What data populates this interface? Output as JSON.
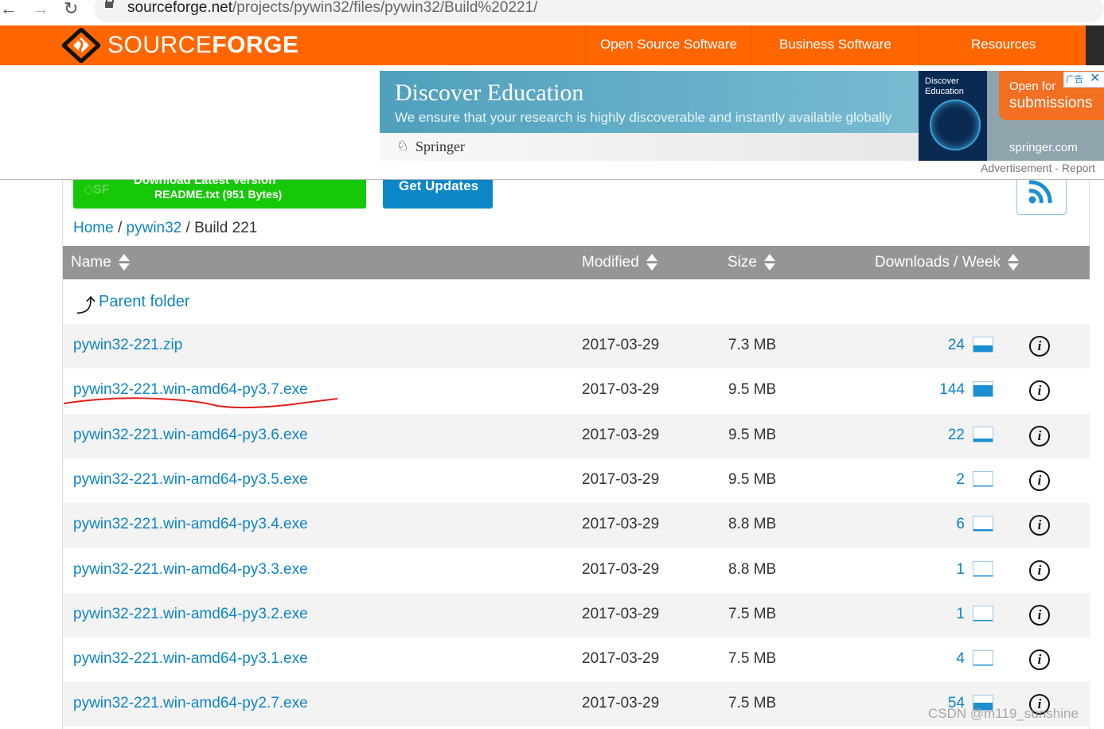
{
  "browser": {
    "url_host": "sourceforge.net",
    "url_path": "/projects/pywin32/files/pywin32/Build%20221/"
  },
  "header": {
    "logo_light": "SOURCE",
    "logo_bold": "FORGE",
    "nav": [
      "Open Source Software",
      "Business Software",
      "Resources"
    ],
    "brand_color": "#ff6600"
  },
  "ad": {
    "title": "Discover Education",
    "subtitle": "We ensure that your research is highly discoverable and instantly available globally",
    "brand": "Springer",
    "book_title": "Discover Education",
    "cta_small": "Open for",
    "cta_big": "submissions",
    "site": "springer.com",
    "badge": "广告",
    "close": "✕",
    "caption": "Advertisement - Report"
  },
  "actions": {
    "download_title": "Download Latest Version",
    "download_sub": "README.txt (951 Bytes)",
    "get_updates": "Get Updates"
  },
  "breadcrumb": {
    "home": "Home",
    "sep1": "/",
    "project": "pywin32",
    "sep2": "/",
    "current": "Build 221"
  },
  "table": {
    "headers": [
      "Name",
      "Modified",
      "Size",
      "Downloads / Week"
    ],
    "parent_folder": "Parent folder",
    "rows": [
      {
        "name": "pywin32-221.zip",
        "modified": "2017-03-29",
        "size": "7.3 MB",
        "downloads": "24",
        "trend": 0.45
      },
      {
        "name": "pywin32-221.win-amd64-py3.7.exe",
        "modified": "2017-03-29",
        "size": "9.5 MB",
        "downloads": "144",
        "trend": 0.8
      },
      {
        "name": "pywin32-221.win-amd64-py3.6.exe",
        "modified": "2017-03-29",
        "size": "9.5 MB",
        "downloads": "22",
        "trend": 0.2
      },
      {
        "name": "pywin32-221.win-amd64-py3.5.exe",
        "modified": "2017-03-29",
        "size": "9.5 MB",
        "downloads": "2",
        "trend": 0.06
      },
      {
        "name": "pywin32-221.win-amd64-py3.4.exe",
        "modified": "2017-03-29",
        "size": "8.8 MB",
        "downloads": "6",
        "trend": 0.1
      },
      {
        "name": "pywin32-221.win-amd64-py3.3.exe",
        "modified": "2017-03-29",
        "size": "8.8 MB",
        "downloads": "1",
        "trend": 0.03
      },
      {
        "name": "pywin32-221.win-amd64-py3.2.exe",
        "modified": "2017-03-29",
        "size": "7.5 MB",
        "downloads": "1",
        "trend": 0.03
      },
      {
        "name": "pywin32-221.win-amd64-py3.1.exe",
        "modified": "2017-03-29",
        "size": "7.5 MB",
        "downloads": "4",
        "trend": 0.08
      },
      {
        "name": "pywin32-221.win-amd64-py2.7.exe",
        "modified": "2017-03-29",
        "size": "7.5 MB",
        "downloads": "54",
        "trend": 0.5
      }
    ]
  },
  "watermark": "CSDN @m119_sunshine",
  "colors": {
    "link": "#0f85c3",
    "header_row": "#959595",
    "download_green": "#17c808",
    "updates_blue": "#0d86c8"
  }
}
